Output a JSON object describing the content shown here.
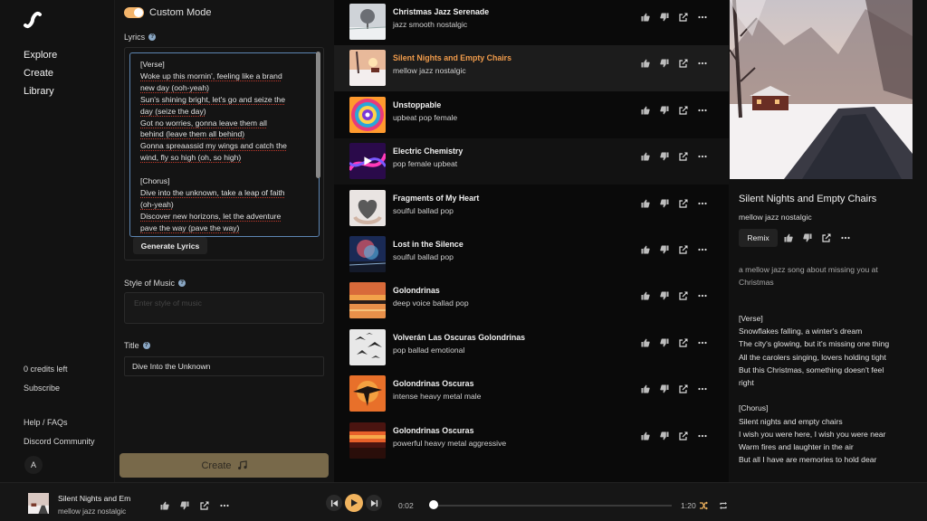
{
  "nav": {
    "links": [
      "Explore",
      "Create",
      "Library"
    ],
    "credits": "0 credits left",
    "subscribe": "Subscribe",
    "help": "Help / FAQs",
    "discord": "Discord Community",
    "avatar_letter": "A"
  },
  "create": {
    "custom_mode_label": "Custom Mode",
    "custom_mode_on": true,
    "lyrics_label": "Lyrics",
    "lyrics_lines": [
      "[Verse]",
      "Woke up this mornin', feeling like a brand",
      "new day (ooh-yeah)",
      "Sun's shining bright, let's go and seize the",
      "day (seize the day)",
      "Got no worries, gonna leave them all",
      "behind (leave them all behind)",
      "Gonna spreaassid my wings and catch the",
      "wind, fly so high (oh, so high)",
      "",
      "[Chorus]",
      "Dive into the unknown, take a leap of faith",
      "(oh-yeah)",
      "Discover new horizons, let the adventure",
      "pave the way (pave the way)"
    ],
    "generate_lyrics_label": "Generate Lyrics",
    "style_label": "Style of Music",
    "style_placeholder": "Enter style of music",
    "title_label": "Title",
    "title_value": "Dive Into the Unknown",
    "create_label": "Create"
  },
  "songs": [
    {
      "title": "Christmas Jazz Serenade",
      "tags": "jazz smooth nostalgic",
      "art": "snow-tree"
    },
    {
      "title": "Silent Nights and Empty Chairs",
      "tags": "mellow jazz nostalgic",
      "art": "snow-sunset",
      "active": true
    },
    {
      "title": "Unstoppable",
      "tags": "upbeat pop female",
      "art": "swirl"
    },
    {
      "title": "Electric Chemistry",
      "tags": "pop female upbeat",
      "art": "neon",
      "hover": true
    },
    {
      "title": "Fragments of My Heart",
      "tags": "soulful ballad pop",
      "art": "heart"
    },
    {
      "title": "Lost in the Silence",
      "tags": "soulful ballad pop",
      "art": "nebula"
    },
    {
      "title": "Golondrinas",
      "tags": "deep voice ballad pop",
      "art": "lake-sunset"
    },
    {
      "title": "Volverán Las Oscuras Golondrinas",
      "tags": "pop ballad emotional",
      "art": "birds-white"
    },
    {
      "title": "Golondrinas Oscuras",
      "tags": "intense heavy metal male",
      "art": "bird-fire"
    },
    {
      "title": "Golondrinas Oscuras",
      "tags": "powerful heavy metal aggressive",
      "art": "fire-sky"
    }
  ],
  "detail": {
    "title": "Silent Nights and Empty Chairs",
    "tags": "mellow jazz nostalgic",
    "remix_label": "Remix",
    "description": "a mellow jazz song about missing you at Christmas",
    "lyrics_lines": [
      "[Verse]",
      "Snowflakes falling, a winter's dream",
      "The city's glowing, but it's missing one thing",
      "All the carolers singing, lovers holding tight",
      "But this Christmas, something doesn't feel",
      "right",
      "",
      "[Chorus]",
      "Silent nights and empty chairs",
      "I wish you were here, I wish you were near",
      "Warm fires and laughter in the air",
      "But all I have are memories to hold dear"
    ]
  },
  "player": {
    "title": "Silent Nights and Em",
    "tags": "mellow jazz nostalgic",
    "current_time": "0:02",
    "total_time": "1:20",
    "progress": 0.02
  },
  "colors": {
    "accent": "#f0b35e",
    "active_title": "#f09b4b",
    "create_button": "#78694a"
  }
}
